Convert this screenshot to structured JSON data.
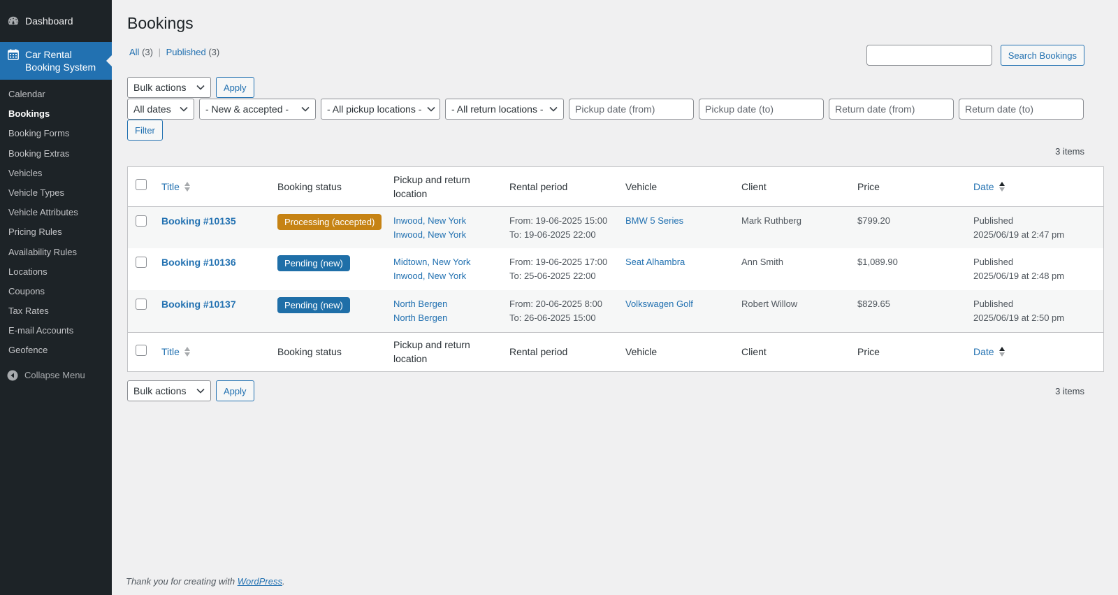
{
  "sidebar": {
    "dashboard_label": "Dashboard",
    "current_label": "Car Rental Booking System",
    "items": [
      {
        "label": "Calendar",
        "active": false
      },
      {
        "label": "Bookings",
        "active": true
      },
      {
        "label": "Booking Forms",
        "active": false
      },
      {
        "label": "Booking Extras",
        "active": false
      },
      {
        "label": "Vehicles",
        "active": false
      },
      {
        "label": "Vehicle Types",
        "active": false
      },
      {
        "label": "Vehicle Attributes",
        "active": false
      },
      {
        "label": "Pricing Rules",
        "active": false
      },
      {
        "label": "Availability Rules",
        "active": false
      },
      {
        "label": "Locations",
        "active": false
      },
      {
        "label": "Coupons",
        "active": false
      },
      {
        "label": "Tax Rates",
        "active": false
      },
      {
        "label": "E-mail Accounts",
        "active": false
      },
      {
        "label": "Geofence",
        "active": false
      }
    ],
    "collapse_label": "Collapse Menu"
  },
  "page": {
    "title": "Bookings",
    "views": {
      "all_label": "All",
      "all_count": "(3)",
      "separator": "|",
      "published_label": "Published",
      "published_count": "(3)"
    },
    "search": {
      "value": "",
      "button_label": "Search Bookings"
    },
    "bulk_top": {
      "selected": "Bulk actions",
      "apply_label": "Apply"
    },
    "filters": {
      "dates": "All dates",
      "status": "- New & accepted -",
      "pickup_locations": "- All pickup locations -",
      "return_locations": "- All return locations -",
      "pickup_from_placeholder": "Pickup date (from)",
      "pickup_to_placeholder": "Pickup date (to)",
      "return_from_placeholder": "Return date (from)",
      "return_to_placeholder": "Return date (to)",
      "filter_label": "Filter"
    },
    "items_count": "3 items",
    "bulk_bottom": {
      "selected": "Bulk actions",
      "apply_label": "Apply"
    }
  },
  "table": {
    "columns": {
      "title": "Title",
      "status": "Booking status",
      "location": "Pickup and return location",
      "period": "Rental period",
      "vehicle": "Vehicle",
      "client": "Client",
      "price": "Price",
      "date": "Date"
    },
    "rows": [
      {
        "title": "Booking #10135",
        "status": "Processing (accepted)",
        "status_color": "#c68314",
        "pickup": "Inwood, New York",
        "return": "Inwood, New York",
        "from": "From: 19-06-2025 15:00",
        "to": "To: 19-06-2025 22:00",
        "vehicle": "BMW 5 Series",
        "client": "Mark Ruthberg",
        "price": "$799.20",
        "date_status": "Published",
        "date": "2025/06/19 at 2:47 pm"
      },
      {
        "title": "Booking #10136",
        "status": "Pending (new)",
        "status_color": "#1f6fa8",
        "pickup": "Midtown, New York",
        "return": "Inwood, New York",
        "from": "From: 19-06-2025 17:00",
        "to": "To: 25-06-2025 22:00",
        "vehicle": "Seat Alhambra",
        "client": "Ann Smith",
        "price": "$1,089.90",
        "date_status": "Published",
        "date": "2025/06/19 at 2:48 pm"
      },
      {
        "title": "Booking #10137",
        "status": "Pending (new)",
        "status_color": "#1f6fa8",
        "pickup": "North Bergen",
        "return": "North Bergen",
        "from": "From: 20-06-2025 8:00",
        "to": "To: 26-06-2025 15:00",
        "vehicle": "Volkswagen Golf",
        "client": "Robert Willow",
        "price": "$829.65",
        "date_status": "Published",
        "date": "2025/06/19 at 2:50 pm"
      }
    ]
  },
  "footer": {
    "prefix": "Thank you for creating with",
    "link": "WordPress",
    "suffix": "."
  },
  "colors": {
    "sidebar_bg": "#1d2327",
    "accent": "#2271b1",
    "processing": "#c68314",
    "pending": "#1f6fa8"
  }
}
